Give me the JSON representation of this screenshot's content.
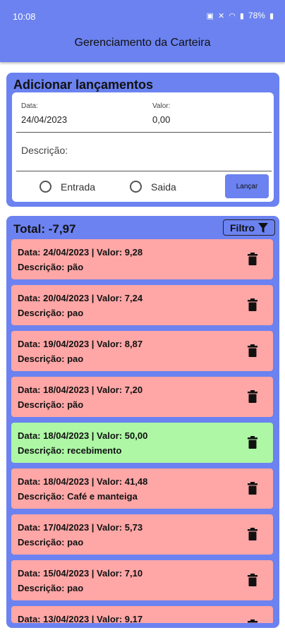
{
  "status_bar": {
    "time": "10:08",
    "battery": "78%"
  },
  "app_bar": {
    "title": "Gerenciamento da Carteira"
  },
  "add_section": {
    "heading": "Adicionar lançamentos",
    "date_label": "Data:",
    "date_value": "24/04/2023",
    "value_label": "Valor:",
    "value_value": "0,00",
    "description_placeholder": "Descrição:",
    "radio_entrada": "Entrada",
    "radio_saida": "Saida",
    "submit_label": "Lançar"
  },
  "list_section": {
    "total_label": "Total: -7,97",
    "filter_label": "Filtro",
    "items": [
      {
        "line1": "Data: 24/04/2023 | Valor: 9,28",
        "line2": "Descrição: pão",
        "kind": "saida"
      },
      {
        "line1": "Data: 20/04/2023 | Valor: 7,24",
        "line2": "Descrição: pao",
        "kind": "saida"
      },
      {
        "line1": "Data: 19/04/2023 | Valor: 8,87",
        "line2": "Descrição: pao",
        "kind": "saida"
      },
      {
        "line1": "Data: 18/04/2023 | Valor: 7,20",
        "line2": "Descrição: pão",
        "kind": "saida"
      },
      {
        "line1": "Data: 18/04/2023 | Valor: 50,00",
        "line2": "Descrição: recebimento",
        "kind": "entrada"
      },
      {
        "line1": "Data: 18/04/2023 | Valor: 41,48",
        "line2": "Descrição: Café e manteiga",
        "kind": "saida"
      },
      {
        "line1": "Data: 17/04/2023 | Valor: 5,73",
        "line2": "Descrição: pao",
        "kind": "saida"
      },
      {
        "line1": "Data: 15/04/2023 | Valor: 7,10",
        "line2": "Descrição: pao",
        "kind": "saida"
      },
      {
        "line1": "Data: 13/04/2023 | Valor: 9,17",
        "line2": "",
        "kind": "saida"
      }
    ]
  },
  "colors": {
    "primary": "#6b82f0",
    "saida_bg": "#ffa6a6",
    "entrada_bg": "#adf7a5"
  },
  "icons": {
    "trash": "trash-icon",
    "filter": "filter-icon"
  }
}
